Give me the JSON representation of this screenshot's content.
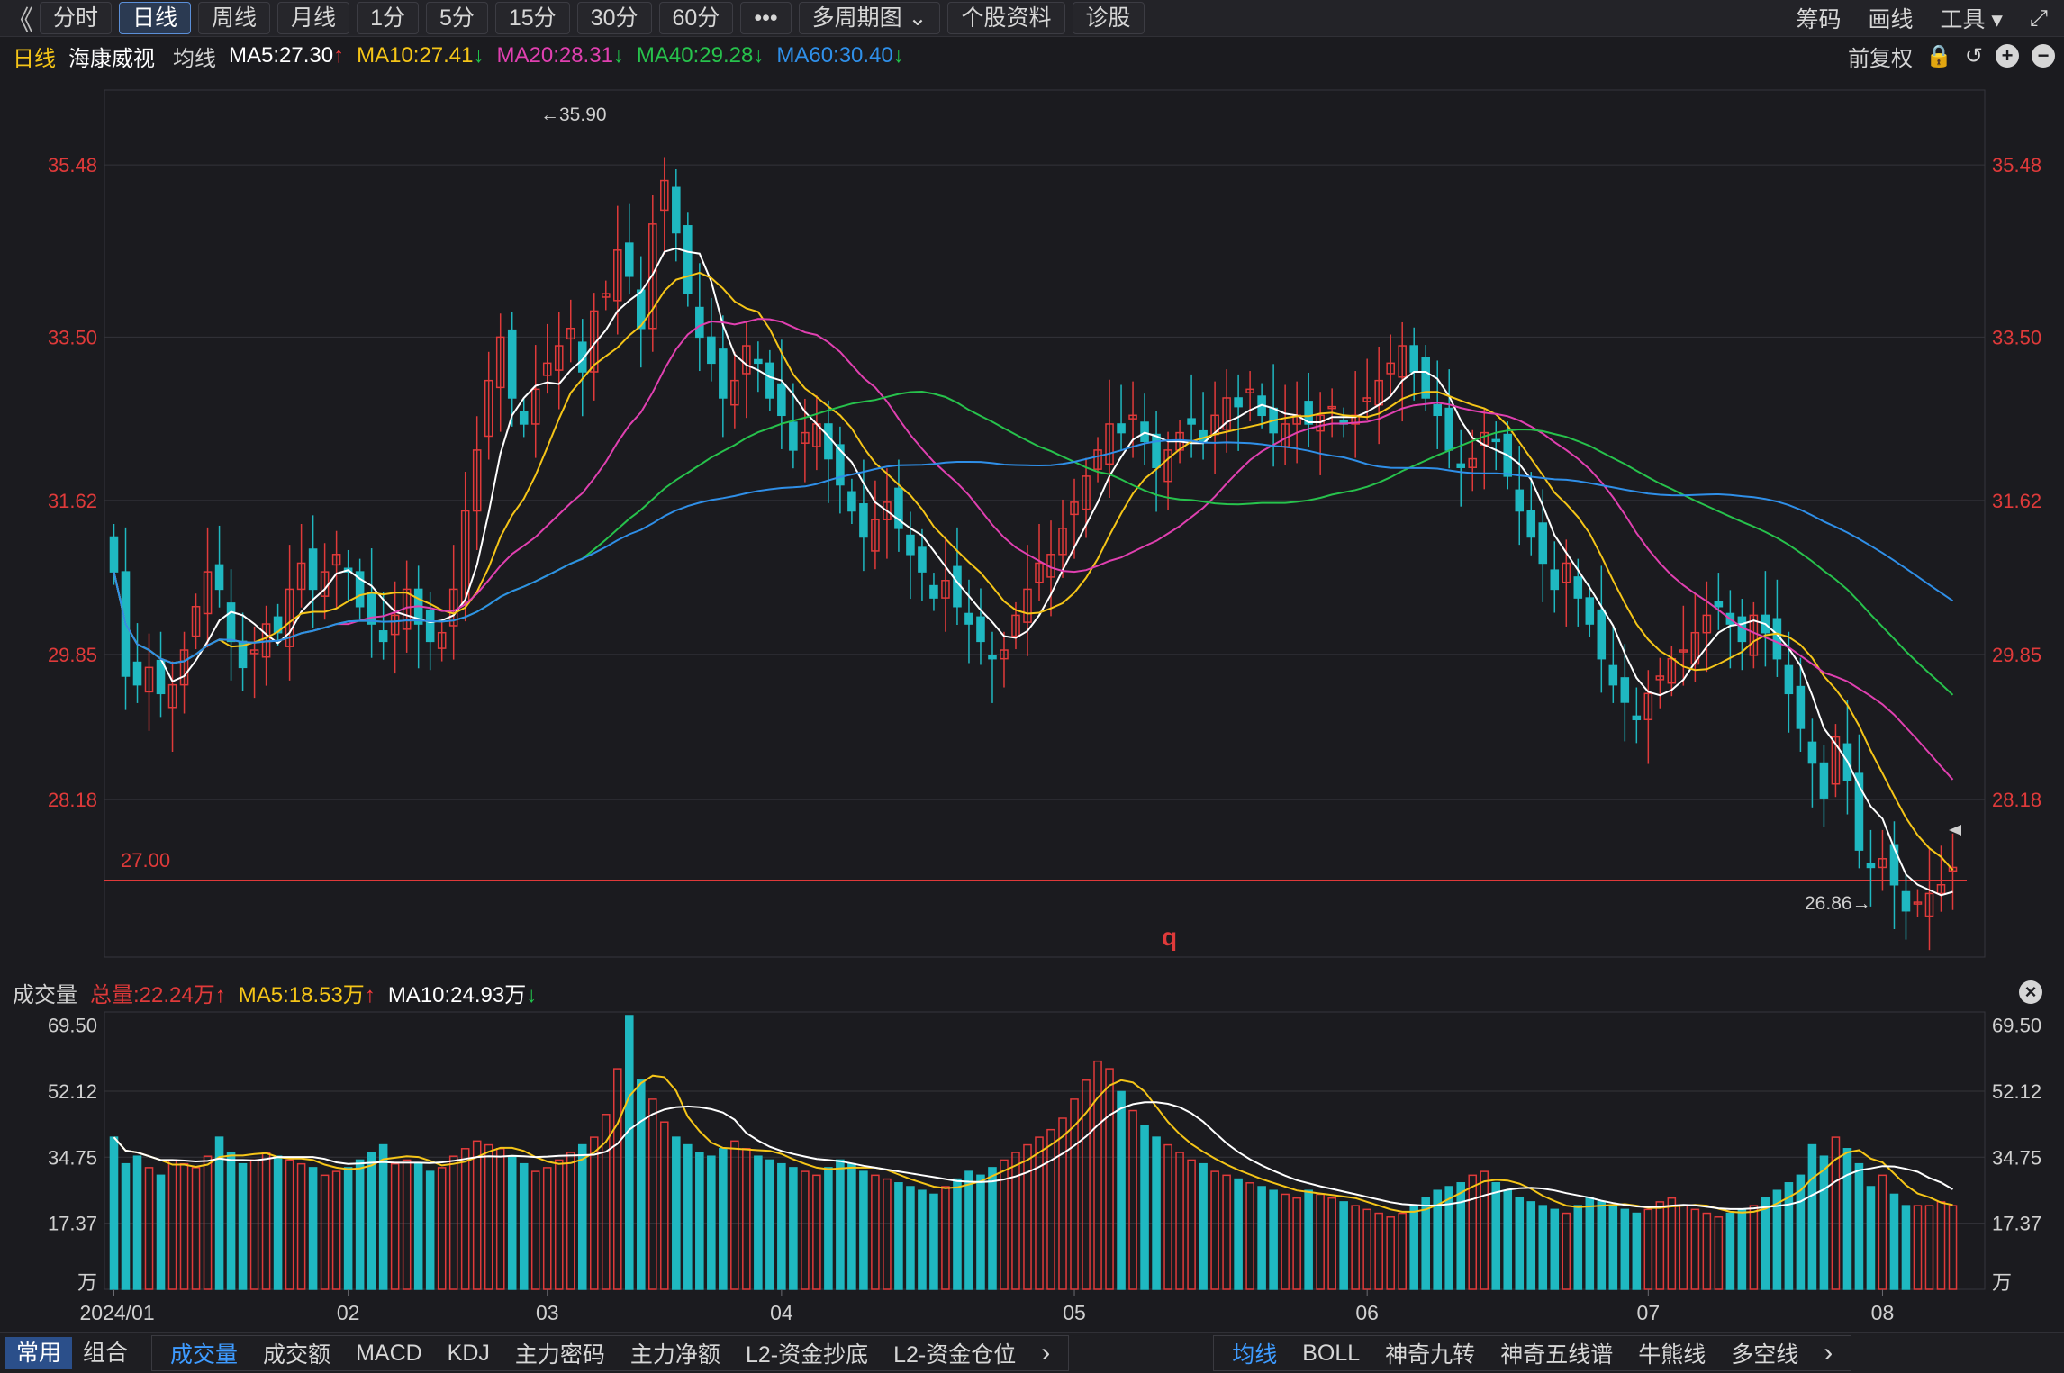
{
  "toolbar": {
    "back": "《",
    "tabs": [
      "分时",
      "日线",
      "周线",
      "月线",
      "1分",
      "5分",
      "15分",
      "30分",
      "60分",
      "•••",
      "多周期图 ⌄",
      "个股资料",
      "诊股"
    ],
    "active_tab": 1,
    "right_items": [
      "筹码",
      "画线",
      "工具 ▾"
    ],
    "expand_icon": "⤢"
  },
  "info": {
    "period": "日线",
    "stock_name": "海康威视",
    "ma_label": "均线",
    "ma5": "MA5:27.30",
    "ma10": "MA10:27.41",
    "ma20": "MA20:28.31",
    "ma40": "MA40:29.28",
    "ma60": "MA60:30.40",
    "adjust": "前复权"
  },
  "price_panel": {
    "y_ticks": [
      "35.48",
      "33.50",
      "31.62",
      "29.85",
      "28.18"
    ],
    "high_mark": "←35.90",
    "low_mark": "26.86→",
    "line_label": "27.00",
    "center_label": "q"
  },
  "volume_info": {
    "title": "成交量",
    "total": "总量:22.24万",
    "ma5": "MA5:18.53万",
    "ma10": "MA10:24.93万"
  },
  "volume_panel": {
    "y_ticks": [
      "69.50",
      "52.12",
      "34.75",
      "17.37",
      "万"
    ]
  },
  "x_labels": [
    "2024/01",
    "02",
    "03",
    "04",
    "05",
    "06",
    "07",
    "08"
  ],
  "bottom": {
    "left_tabs": [
      "常用",
      "组合"
    ],
    "indicators": [
      "成交量",
      "成交额",
      "MACD",
      "KDJ",
      "主力密码",
      "主力净额",
      "L2-资金抄底",
      "L2-资金仓位"
    ],
    "indicators_selected": 0,
    "overlays": [
      "均线",
      "BOLL",
      "神奇九转",
      "神奇五线谱",
      "牛熊线",
      "多空线"
    ],
    "overlays_selected": 0
  },
  "colors": {
    "up": "#e03a3a",
    "down": "#1fb8c1",
    "ma5": "#ffffff",
    "ma10": "#f5c518",
    "ma20": "#e040b0",
    "ma40": "#27c24c",
    "ma60": "#2f8fe8",
    "arrow_up": "#ff3b3b",
    "arrow_down": "#21c24a"
  },
  "chart_data": {
    "type": "candlestick",
    "price_range": [
      26.4,
      36.3
    ],
    "volume_range": [
      0,
      72
    ],
    "closes": [
      30.8,
      29.6,
      29.5,
      29.7,
      29.4,
      29.5,
      29.9,
      30.4,
      30.8,
      30.6,
      30.0,
      29.7,
      29.9,
      30.2,
      30.1,
      30.6,
      30.9,
      30.6,
      30.8,
      31.0,
      30.8,
      30.4,
      30.2,
      30.0,
      30.3,
      30.6,
      30.2,
      30.0,
      30.1,
      30.6,
      31.5,
      32.2,
      33.0,
      33.5,
      32.8,
      32.5,
      32.9,
      33.2,
      33.4,
      33.6,
      33.1,
      33.8,
      34.0,
      34.5,
      34.2,
      33.6,
      34.8,
      35.3,
      34.7,
      34.0,
      33.5,
      33.2,
      32.8,
      33.0,
      33.4,
      33.2,
      32.8,
      32.6,
      32.2,
      32.4,
      32.5,
      32.1,
      31.8,
      31.5,
      31.2,
      31.4,
      31.6,
      31.3,
      31.0,
      30.8,
      30.5,
      30.7,
      30.4,
      30.2,
      30.0,
      29.8,
      29.9,
      30.3,
      30.6,
      30.9,
      31.0,
      31.3,
      31.6,
      31.9,
      32.2,
      32.5,
      32.4,
      32.6,
      32.3,
      32.0,
      32.2,
      32.4,
      32.5,
      32.3,
      32.6,
      32.8,
      32.7,
      32.9,
      32.6,
      32.4,
      32.5,
      32.6,
      32.5,
      32.6,
      32.7,
      32.5,
      32.6,
      32.8,
      33.0,
      33.2,
      33.4,
      33.1,
      32.8,
      32.6,
      32.2,
      32.0,
      32.1,
      32.4,
      32.3,
      31.9,
      31.5,
      31.2,
      30.9,
      30.6,
      30.9,
      30.5,
      30.2,
      29.8,
      29.5,
      29.3,
      29.1,
      29.4,
      29.6,
      29.8,
      29.9,
      30.1,
      30.3,
      30.4,
      30.2,
      30.0,
      30.3,
      30.1,
      29.8,
      29.4,
      29.0,
      28.6,
      28.2,
      28.9,
      28.4,
      27.6,
      27.4,
      27.5,
      27.2,
      26.9,
      27.0,
      27.1,
      27.2,
      27.4
    ],
    "volumes": [
      40,
      33,
      35,
      32,
      30,
      34,
      33,
      32,
      35,
      40,
      36,
      33,
      34,
      36,
      35,
      34,
      33,
      32,
      30,
      31,
      32,
      34,
      36,
      38,
      33,
      34,
      33,
      31,
      32,
      35,
      37,
      39,
      38,
      37,
      35,
      33,
      31,
      32,
      34,
      36,
      38,
      40,
      46,
      58,
      72,
      55,
      50,
      44,
      40,
      38,
      36,
      35,
      37,
      39,
      37,
      35,
      34,
      33,
      32,
      31,
      30,
      32,
      34,
      33,
      31,
      30,
      29,
      28,
      27,
      26,
      25,
      27,
      29,
      31,
      30,
      32,
      34,
      36,
      38,
      40,
      42,
      45,
      50,
      55,
      60,
      58,
      52,
      47,
      43,
      40,
      38,
      36,
      34,
      33,
      31,
      30,
      29,
      28,
      27,
      26,
      25,
      24,
      26,
      25,
      24,
      23,
      22,
      21,
      20,
      19,
      20,
      22,
      24,
      26,
      27,
      28,
      30,
      31,
      28,
      26,
      24,
      23,
      22,
      21,
      20,
      22,
      24,
      23,
      22,
      21,
      20,
      21,
      23,
      24,
      22,
      21,
      20,
      19,
      20,
      21,
      22,
      24,
      26,
      28,
      30,
      38,
      35,
      40,
      37,
      33,
      27,
      30,
      25,
      22,
      22,
      22,
      23,
      22
    ]
  }
}
